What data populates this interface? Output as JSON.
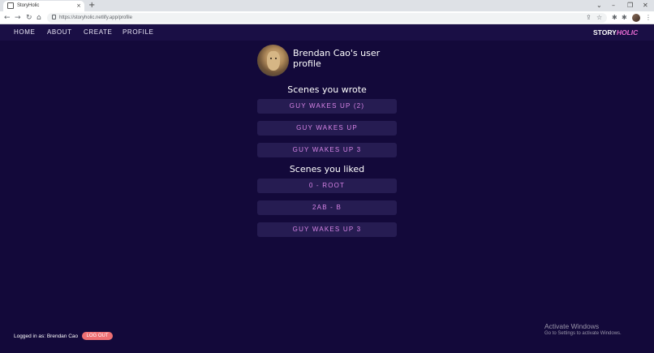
{
  "browser": {
    "tab_title": "StoryHolic",
    "tab_close": "×",
    "new_tab": "+",
    "url": "https://storyholic.netlify.app/profile",
    "back": "←",
    "forward": "→",
    "reload": "↻",
    "home": "⌂",
    "minimize": "–",
    "restore": "❐",
    "close": "✕",
    "tab_search": "⌄",
    "share": "⇪",
    "star": "☆",
    "extension": "✱",
    "menu": "⋮"
  },
  "nav": {
    "items": [
      {
        "label": "HOME"
      },
      {
        "label": "ABOUT"
      },
      {
        "label": "CREATE"
      },
      {
        "label": "PROFILE"
      }
    ],
    "brand_main": "STORY",
    "brand_accent": "HOLIC"
  },
  "profile": {
    "title": "Brendan Cao's user profile",
    "wrote_heading": "Scenes you wrote",
    "wrote": [
      {
        "label": "GUY WAKES UP (2)"
      },
      {
        "label": "GUY WAKES UP"
      },
      {
        "label": "GUY WAKES UP 3"
      }
    ],
    "liked_heading": "Scenes you liked",
    "liked": [
      {
        "label": "0 - ROOT"
      },
      {
        "label": "2AB - B"
      },
      {
        "label": "GUY WAKES UP 3"
      }
    ]
  },
  "footer": {
    "logged_in": "Logged in as: Brendan Cao",
    "logout": "LOG OUT"
  },
  "watermark": {
    "title": "Activate Windows",
    "subtitle": "Go to Settings to activate Windows."
  },
  "colors": {
    "page_bg": "#13093a",
    "nav_bg": "#1a0f45",
    "button_bg": "#261c52",
    "button_text": "#d784e6",
    "brand_accent": "#e86bd3",
    "logout_bg": "#ee6f73"
  }
}
